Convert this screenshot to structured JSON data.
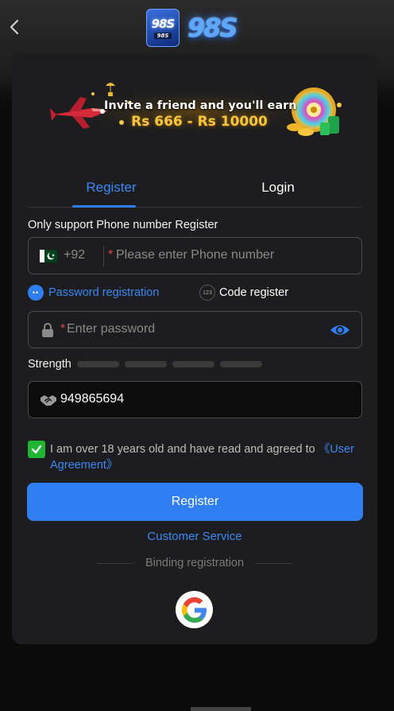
{
  "header": {
    "logo_badge_text": "98S",
    "logo_badge_sub": "98S",
    "logo_text": "98S"
  },
  "banner": {
    "line1": "Invite a friend and you'll earn",
    "line2": "Rs 666 - Rs 10000"
  },
  "tabs": [
    {
      "label": "Register",
      "active": true
    },
    {
      "label": "Login",
      "active": false
    }
  ],
  "form": {
    "support_text": "Only support Phone number Register",
    "country_code": "+92",
    "phone_placeholder": "Please enter Phone number",
    "required_mark": "*",
    "mode_password_label": "Password registration",
    "mode_code_label": "Code register",
    "mode_code_icon_text": "123",
    "password_placeholder": "Enter password",
    "strength_label": "Strength",
    "invite_code_value": "949865694",
    "agree_text": "I am over 18 years old and have read and agreed to ",
    "agree_link": "《User Agreement》",
    "agree_checked": true,
    "register_button": "Register"
  },
  "footer": {
    "customer_service": "Customer Service",
    "binding_label": "Binding registration"
  },
  "colors": {
    "accent": "#2f7ff2",
    "checkbox_green": "#1fb532",
    "card_bg": "#1d1d1f",
    "page_bg": "#0b0b0b"
  },
  "icons": [
    "chevron-left-icon",
    "pakistan-flag-icon",
    "lock-icon",
    "eye-icon",
    "handshake-icon",
    "check-icon",
    "google-icon"
  ]
}
